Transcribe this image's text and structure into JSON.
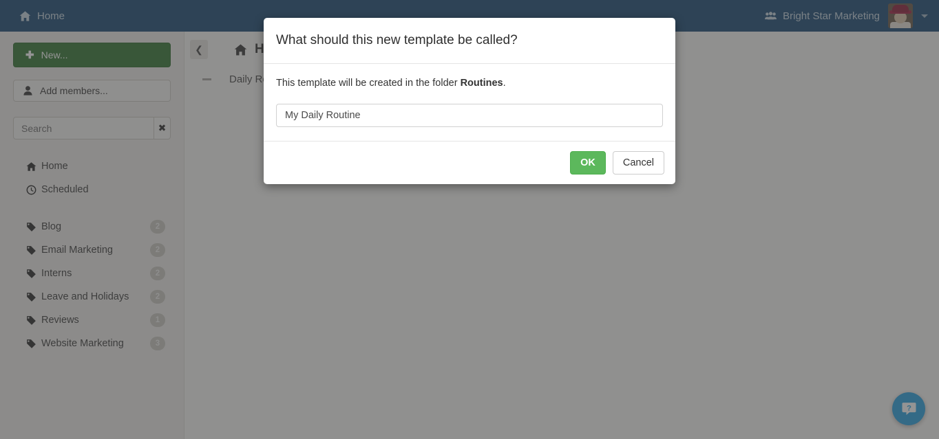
{
  "topbar": {
    "home_label": "Home",
    "home_icon": "home-icon",
    "org_label": "Bright Star Marketing",
    "org_icon": "users-group-icon",
    "avatar_alt": "user-avatar",
    "caret_icon": "chevron-down-icon",
    "bg_color": "#1e4d75"
  },
  "sidebar": {
    "new_button": {
      "label": "New...",
      "icon": "plus-icon",
      "color": "#357935"
    },
    "add_members_button": {
      "label": "Add members...",
      "icon": "person-icon"
    },
    "search": {
      "value": "",
      "placeholder": "Search",
      "clear_icon": "close-x-icon"
    },
    "items": [
      {
        "label": "Home",
        "icon": "home-icon",
        "badge": ""
      },
      {
        "label": "Scheduled",
        "icon": "clock-icon",
        "badge": ""
      }
    ],
    "tags": [
      {
        "label": "Blog",
        "icon": "tag-icon",
        "badge": "2"
      },
      {
        "label": "Email Marketing",
        "icon": "tag-icon",
        "badge": "2"
      },
      {
        "label": "Interns",
        "icon": "tag-icon",
        "badge": "2"
      },
      {
        "label": "Leave and Holidays",
        "icon": "tag-icon",
        "badge": "2"
      },
      {
        "label": "Reviews",
        "icon": "tag-icon",
        "badge": "1"
      },
      {
        "label": "Website Marketing",
        "icon": "tag-icon",
        "badge": "3"
      }
    ]
  },
  "main": {
    "collapse_icon": "chevron-left-icon",
    "breadcrumb": {
      "label": "Home",
      "icon": "home-icon"
    },
    "rows": [
      {
        "label": "Daily Routine",
        "marker": "collapse-dash"
      }
    ]
  },
  "help": {
    "icon": "question-chat-icon",
    "color": "#2ba2e0"
  },
  "modal": {
    "title": "What should this new template be called?",
    "body_prefix": "This template will be created in the folder ",
    "body_folder": "Routines",
    "body_suffix": ".",
    "input_value": "My Daily Routine",
    "input_placeholder": "",
    "ok_label": "OK",
    "cancel_label": "Cancel",
    "ok_color": "#5cb85c"
  }
}
